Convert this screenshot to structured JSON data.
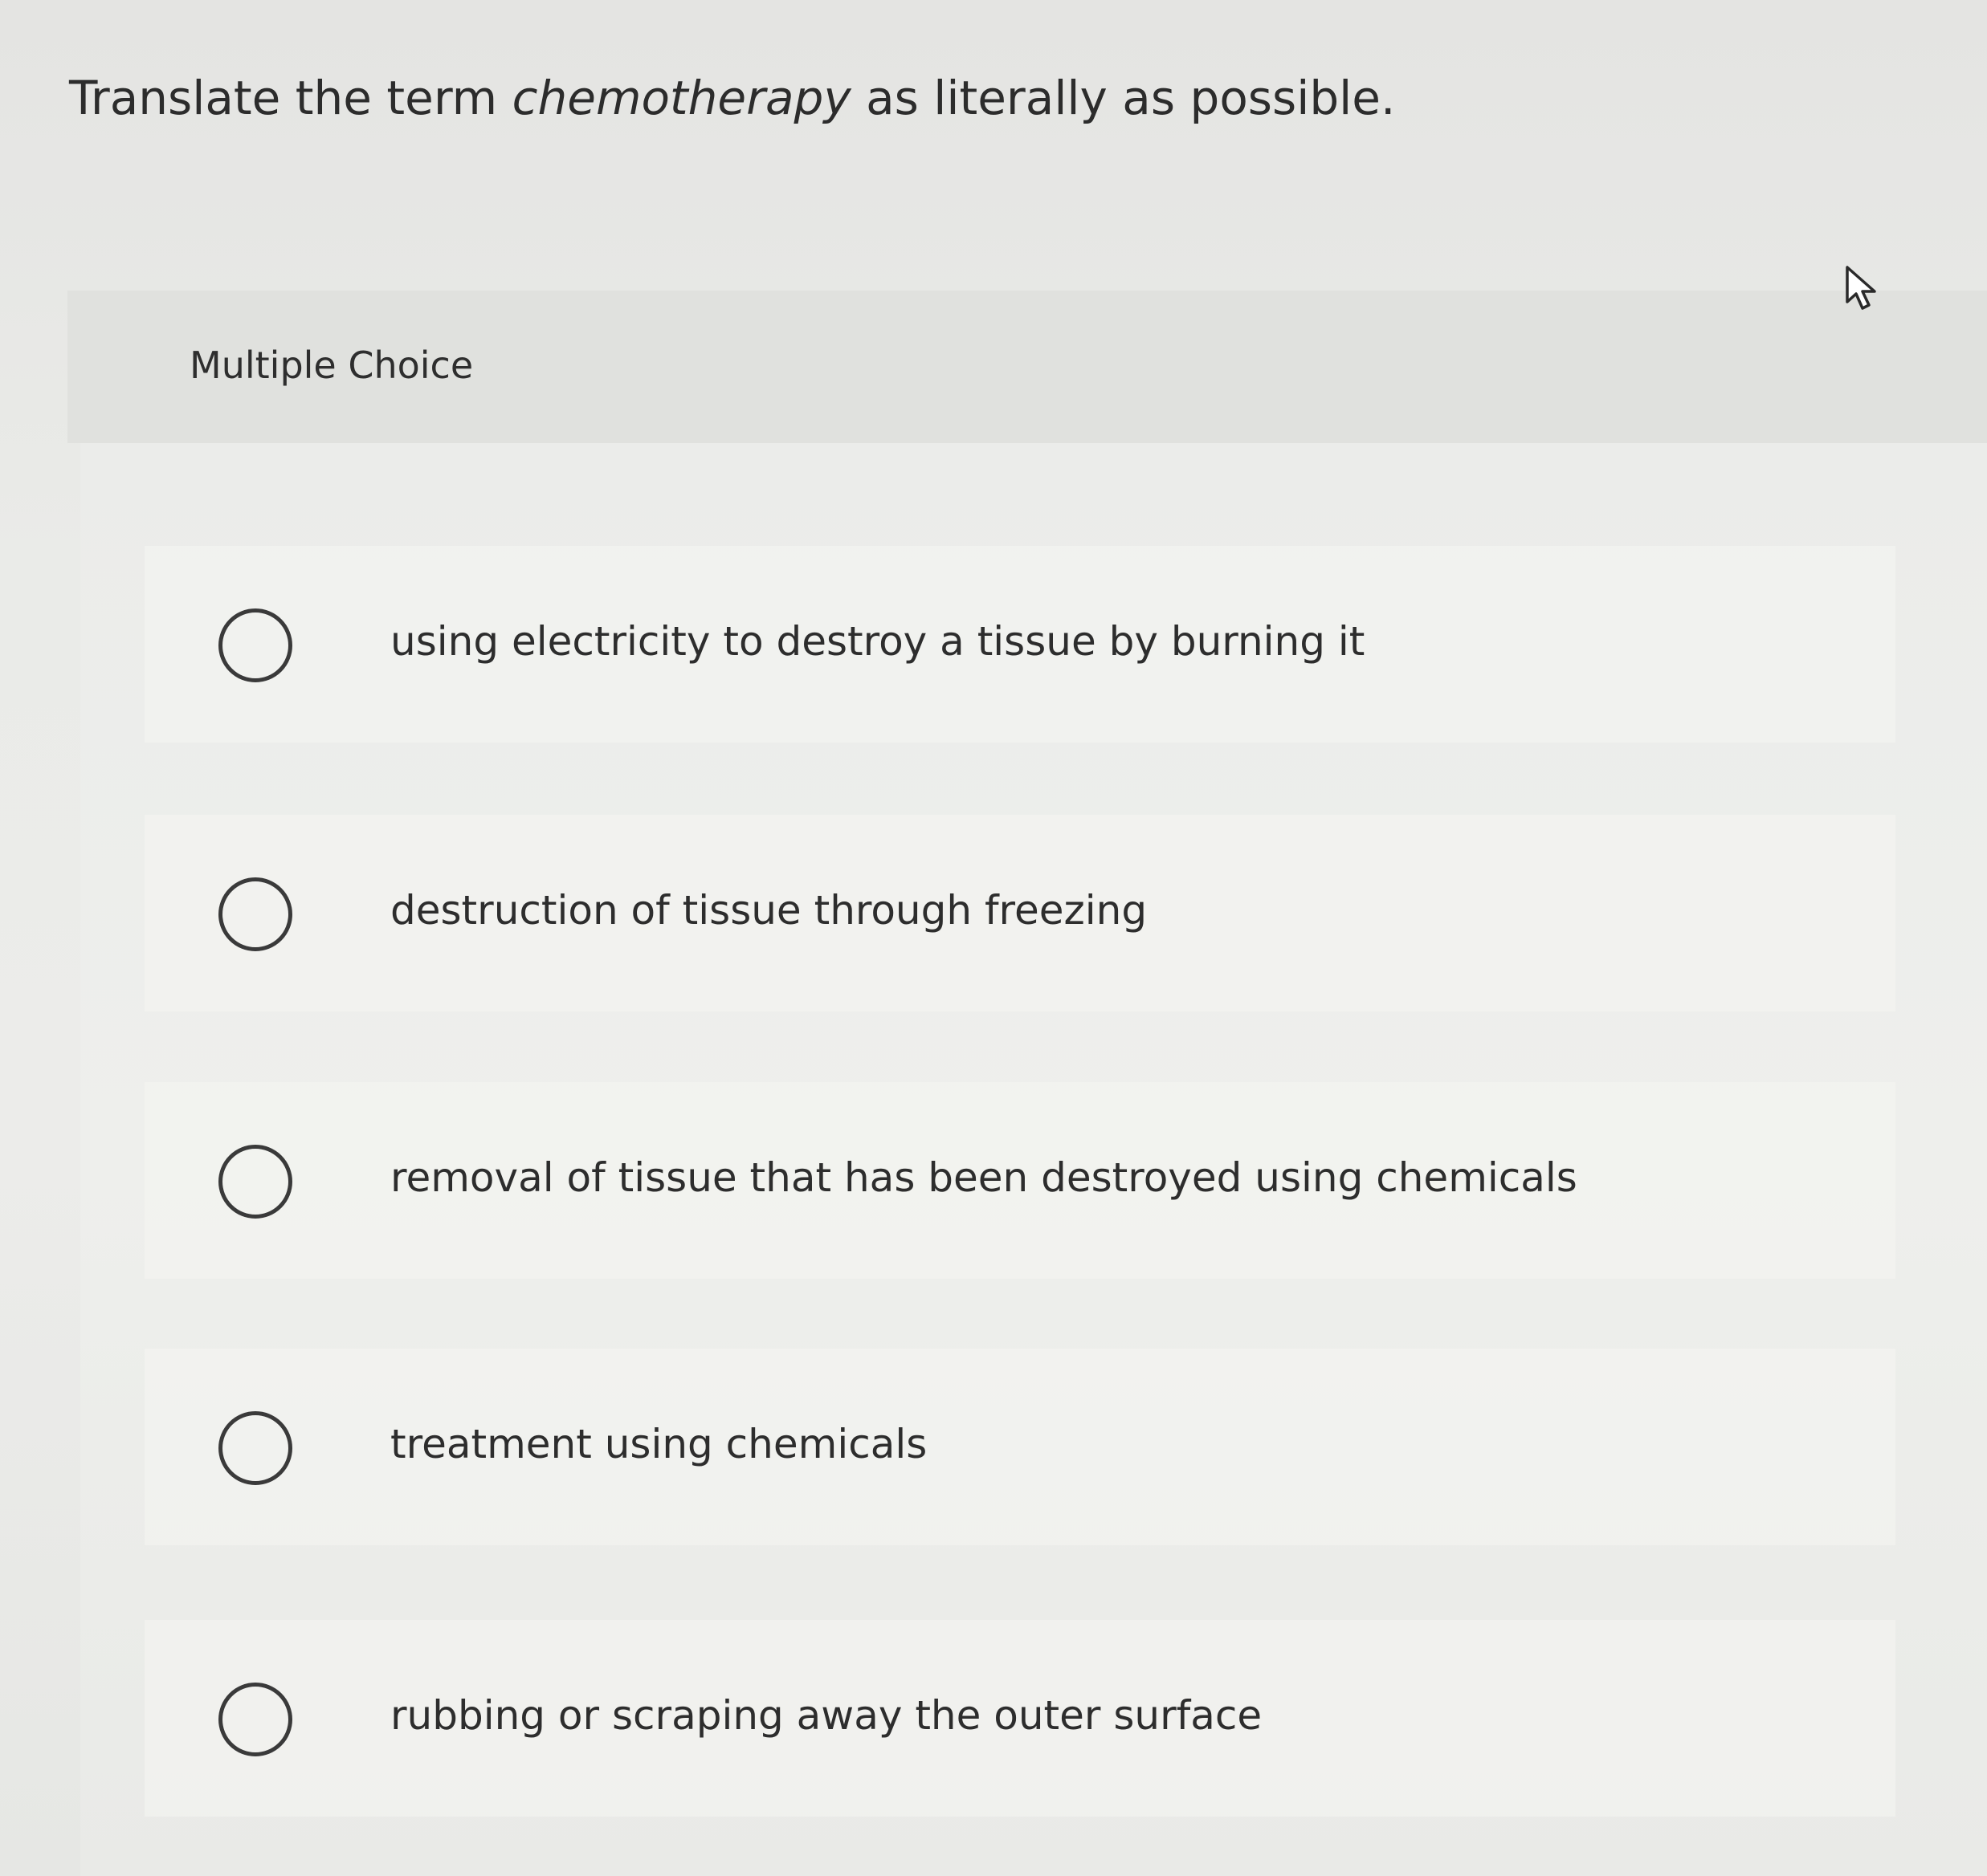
{
  "question": {
    "prefix": "Translate the term ",
    "term": "chemotherapy",
    "suffix": " as literally as possible."
  },
  "multiple_choice": {
    "label": "Multiple Choice",
    "options": [
      {
        "text": "using electricity to destroy a tissue by burning it",
        "selected": false
      },
      {
        "text": "destruction of tissue through freezing",
        "selected": false
      },
      {
        "text": "removal of tissue that has been destroyed using chemicals",
        "selected": false
      },
      {
        "text": "treatment using chemicals",
        "selected": false
      },
      {
        "text": "rubbing or scraping away the outer surface",
        "selected": false
      }
    ]
  },
  "icons": {
    "cursor": "mouse-pointer-icon",
    "radio": "radio-circle-icon"
  }
}
